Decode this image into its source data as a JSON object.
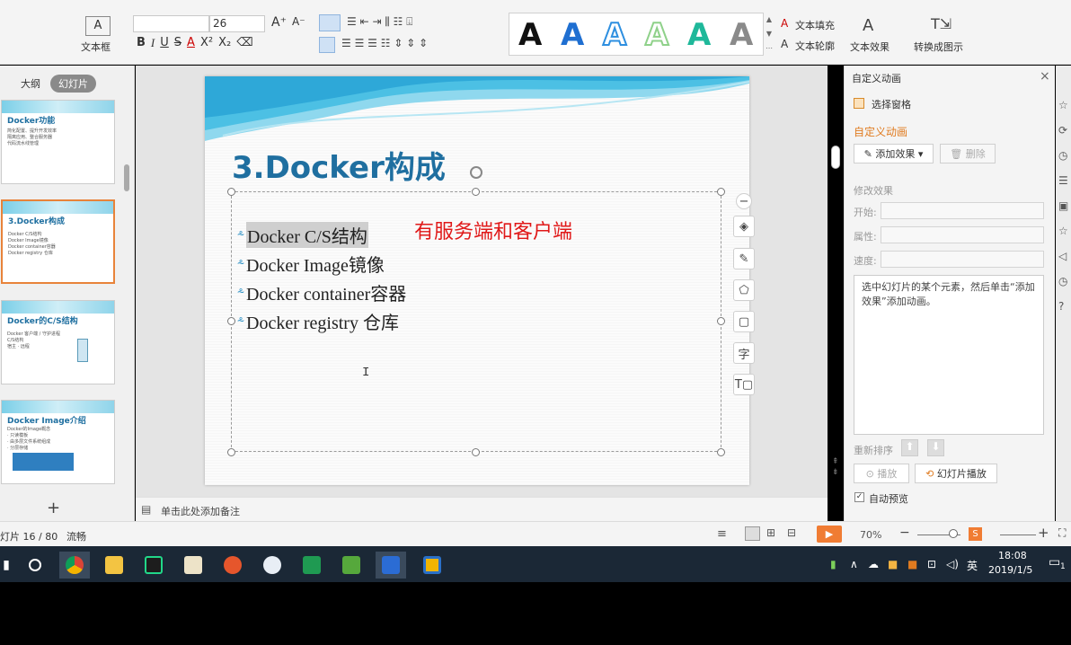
{
  "ribbon": {
    "textbox_label": "文本框",
    "font_size": "26",
    "text_fill": "文本填充",
    "text_outline": "文本轮廓",
    "text_effect": "文本效果",
    "convert_label": "转换成图示",
    "gallery_letter": "A",
    "gallery_colors": [
      "#111111",
      "#1f6fd1",
      "#2e8fe0",
      "#8fd18a",
      "#1fb89a",
      "#8a8a8a"
    ]
  },
  "leftpanel": {
    "tab_outline": "大纲",
    "tab_slides": "幻灯片",
    "add": "+",
    "thumbs": [
      {
        "title": "Docker功能",
        "lines": [
          "简化配置、提升开发效率",
          "隔离应用、整合服务器",
          "代码流水线管理"
        ]
      },
      {
        "title": "3.Docker构成",
        "lines": [
          "Docker C/S结构",
          "Docker Image镜像",
          "Docker container容器",
          "Docker registry 仓库"
        ]
      },
      {
        "title": "Docker的C/S结构",
        "lines": [
          "Docker 客户端 / 守护进程",
          "C/S结构",
          "",
          "宿主 · 远程"
        ]
      },
      {
        "title": "Docker Image介绍",
        "lines": [
          "Docker的Image概念",
          "· 只读模板",
          "· 由多层文件系统组成",
          "· 分层存储"
        ]
      }
    ]
  },
  "slide": {
    "title": "3.Docker构成",
    "bullet_marker": "⸛",
    "bullets": [
      "Docker C/S结构",
      "Docker Image镜像",
      "Docker container容器",
      "Docker registry 仓库"
    ],
    "annotation": "有服务端和客户端",
    "accent": "#1f6fa0"
  },
  "rightpanel": {
    "title": "自定义动画",
    "select_pane": "选择窗格",
    "section": "自定义动画",
    "add_effect": "添加效果",
    "delete": "删除",
    "modify": "修改效果",
    "start": "开始:",
    "property": "属性:",
    "speed": "速度:",
    "hint": "选中幻灯片的某个元素，然后单击“添加效果”添加动画。",
    "reorder": "重新排序",
    "play": "播放",
    "slideshow": "幻灯片播放",
    "autopreview": "自动预览"
  },
  "notes": {
    "placeholder": "单击此处添加备注"
  },
  "status": {
    "slide_count": "灯片 16 / 80",
    "theme": "流畅",
    "zoom": "70%"
  },
  "taskbar": {
    "time": "18:08",
    "date": "2019/1/5",
    "ime": "英",
    "notif": "1"
  }
}
